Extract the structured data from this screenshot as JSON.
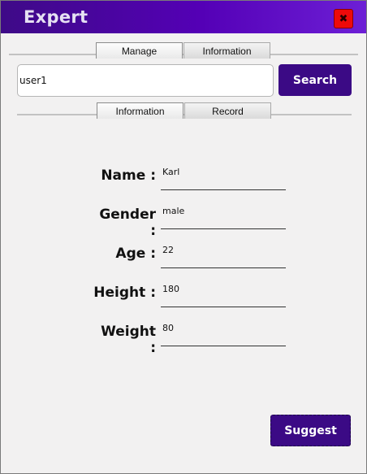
{
  "window": {
    "title": "Expert",
    "close_symbol": "✖",
    "accent_color": "#3b0a85",
    "close_color": "#ee0a0a"
  },
  "top_tabs": [
    {
      "label": "Manage",
      "active": true
    },
    {
      "label": "Information",
      "active": false
    }
  ],
  "search": {
    "value": "user1",
    "button_label": "Search"
  },
  "sub_tabs": [
    {
      "label": "Information",
      "active": true
    },
    {
      "label": "Record",
      "active": false
    }
  ],
  "fields": [
    {
      "label": "Name :",
      "value": "Karl"
    },
    {
      "label": "Gender :",
      "value": "male"
    },
    {
      "label": "Age :",
      "value": "22"
    },
    {
      "label": "Height :",
      "value": "180"
    },
    {
      "label": "Weight :",
      "value": "80"
    }
  ],
  "actions": {
    "suggest_label": "Suggest"
  }
}
